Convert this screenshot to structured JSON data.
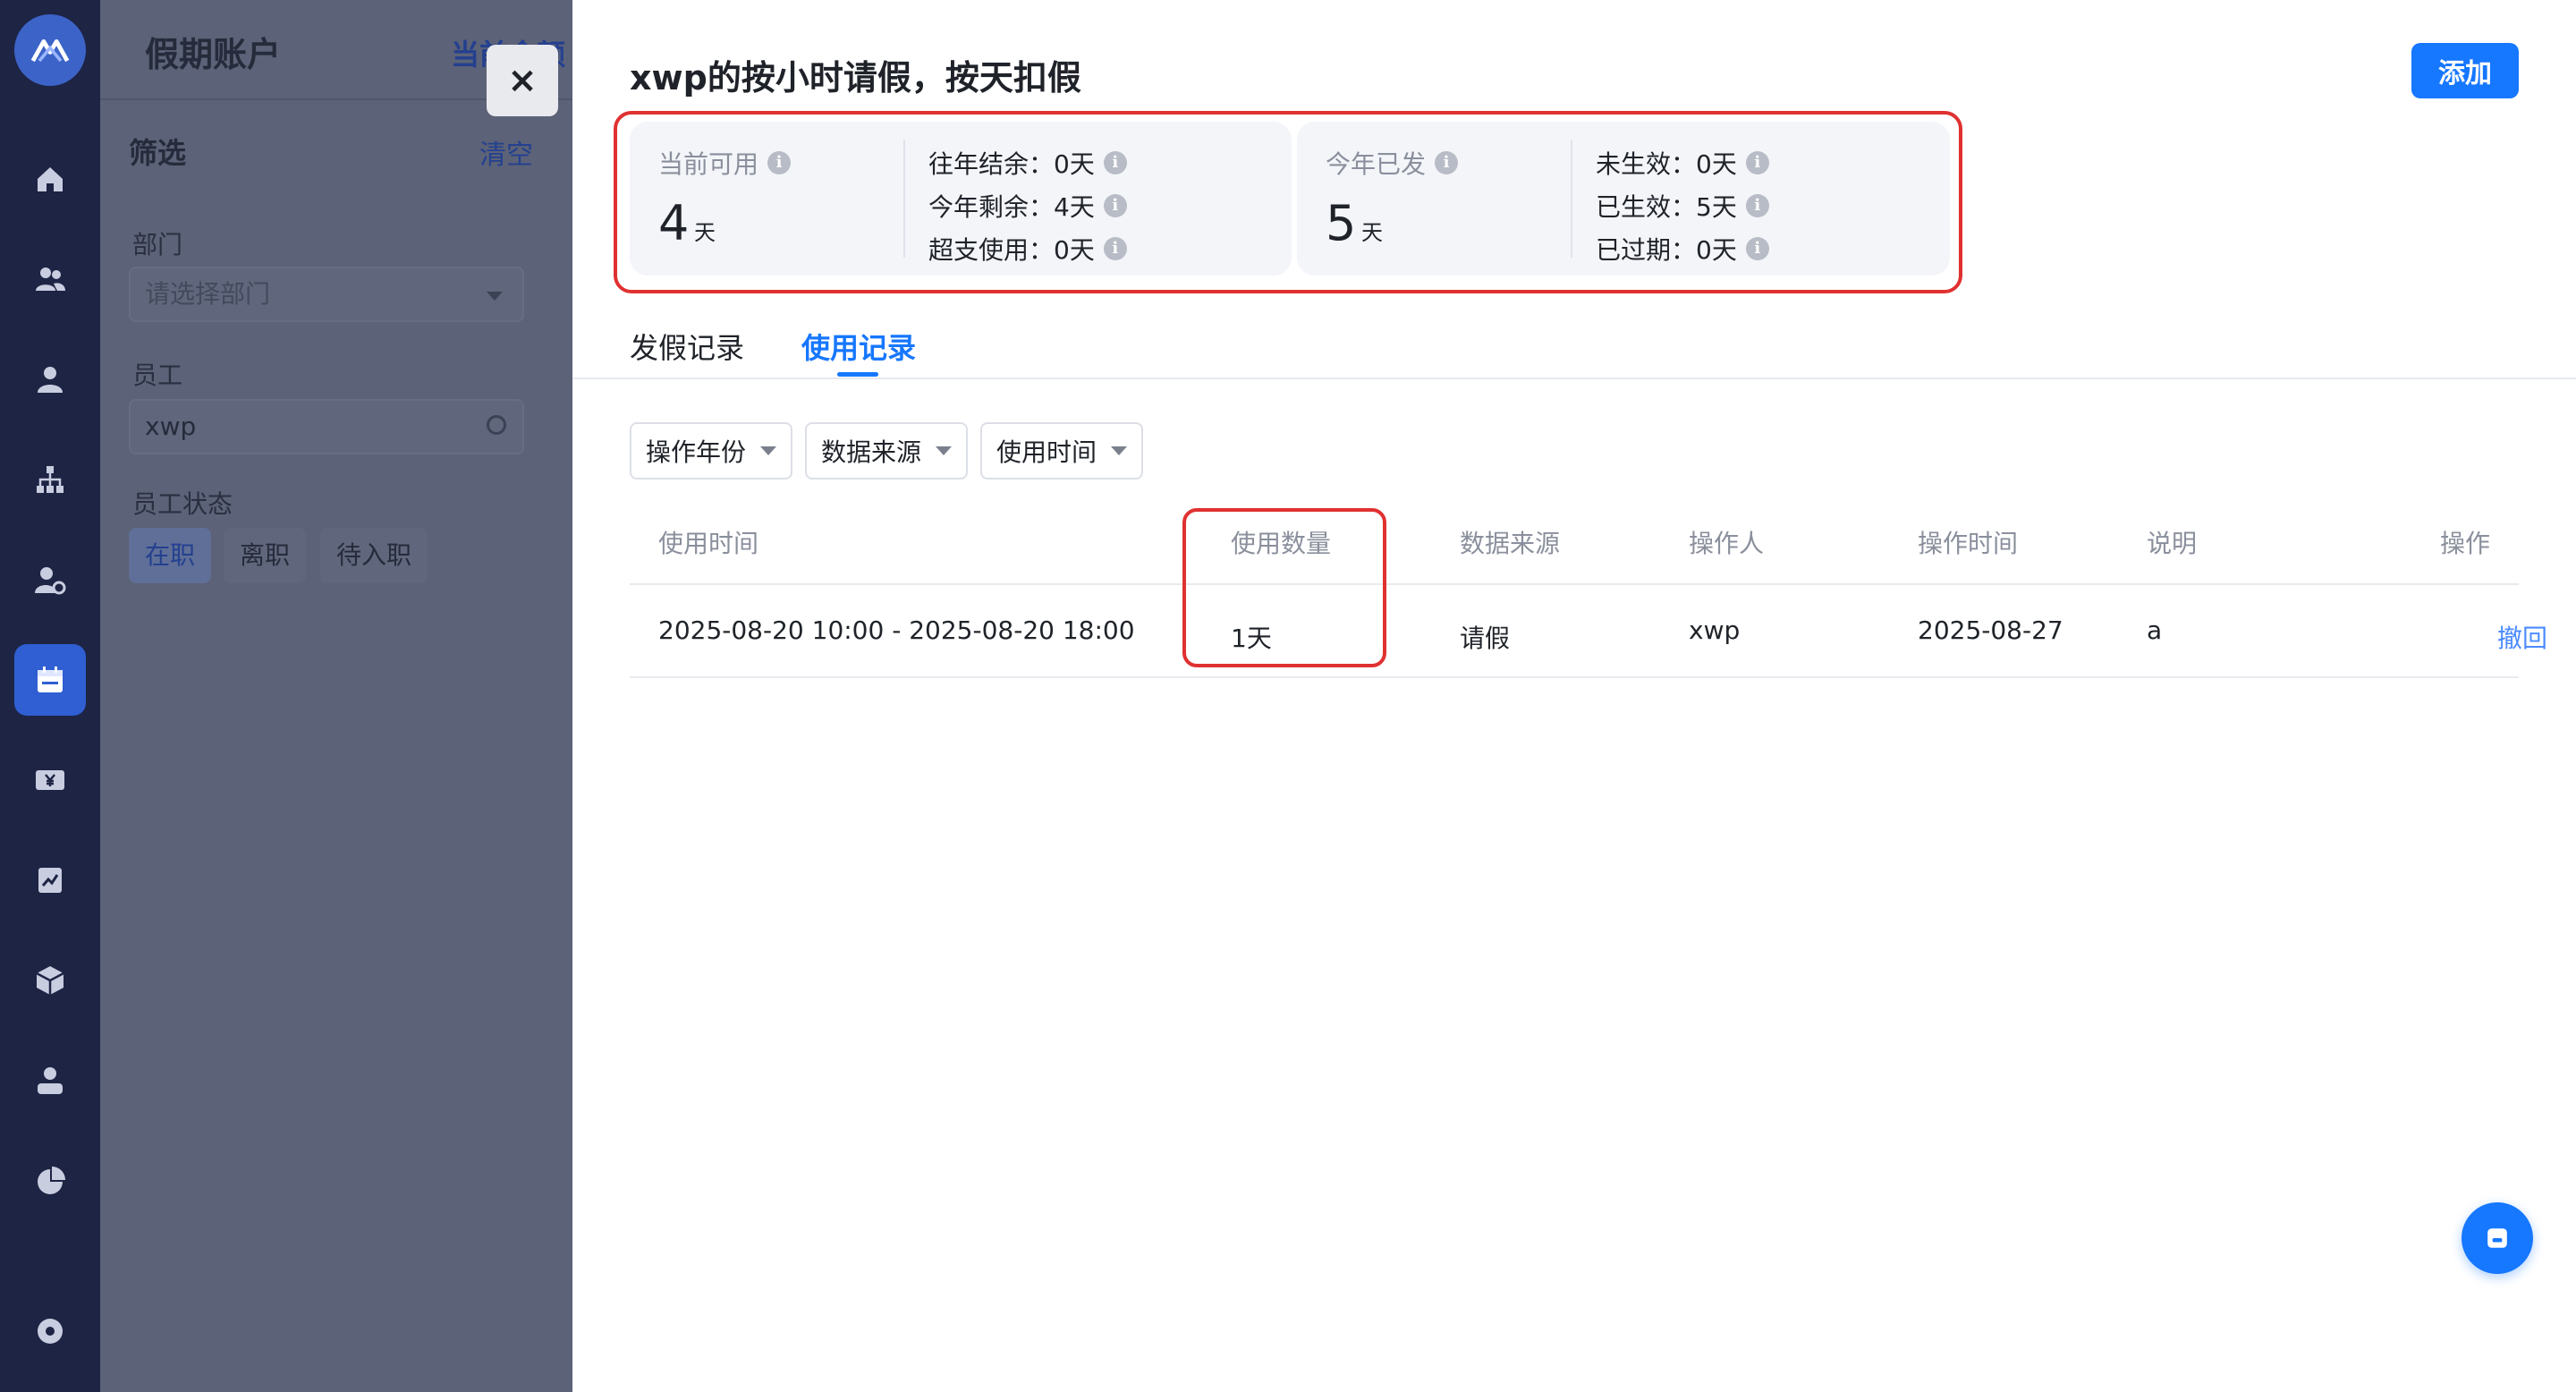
{
  "background": {
    "title": "假期账户",
    "header_link": "当前余额",
    "filter_title": "筛选",
    "clear_label": "清空",
    "department_label": "部门",
    "department_placeholder": "请选择部门",
    "employee_label": "员工",
    "employee_value": "xwp",
    "status_label": "员工状态",
    "status_options": [
      "在职",
      "离职",
      "待入职"
    ],
    "status_selected": "在职"
  },
  "rail": {
    "icons": [
      "app-logo",
      "home-icon",
      "team-icon",
      "user-icon",
      "org-chart-icon",
      "user-settings-icon",
      "calendar-icon",
      "money-icon",
      "report-icon",
      "box-icon",
      "profile-icon",
      "pie-chart-icon",
      "settings-icon"
    ],
    "active": "calendar-icon"
  },
  "drawer": {
    "title": "xwp的按小时请假，按天扣假",
    "add_label": "添加",
    "close_label": "×",
    "summary": {
      "available": {
        "label": "当前可用",
        "value": "4",
        "unit": "天"
      },
      "available_stats": [
        {
          "label": "往年结余：",
          "value": "0天"
        },
        {
          "label": "今年剩余：",
          "value": "4天"
        },
        {
          "label": "超支使用：",
          "value": "0天"
        }
      ],
      "issued": {
        "label": "今年已发",
        "value": "5",
        "unit": "天"
      },
      "issued_stats": [
        {
          "label": "未生效：",
          "value": "0天"
        },
        {
          "label": "已生效：",
          "value": "5天"
        },
        {
          "label": "已过期：",
          "value": "0天"
        }
      ]
    },
    "tabs": [
      {
        "label": "发假记录",
        "active": false
      },
      {
        "label": "使用记录",
        "active": true
      }
    ],
    "filters": [
      "操作年份",
      "数据来源",
      "使用时间"
    ],
    "table": {
      "columns": [
        "使用时间",
        "使用数量",
        "数据来源",
        "操作人",
        "操作时间",
        "说明",
        "操作"
      ],
      "rows": [
        {
          "use_time": "2025-08-20 10:00 - 2025-08-20 18:00",
          "amount": "1天",
          "source": "请假",
          "operator": "xwp",
          "op_time": "2025-08-27",
          "note": "a",
          "action": "撤回"
        }
      ]
    }
  },
  "colors": {
    "accent": "#1677ff",
    "highlight": "#e03131",
    "rail": "#1d2444"
  }
}
